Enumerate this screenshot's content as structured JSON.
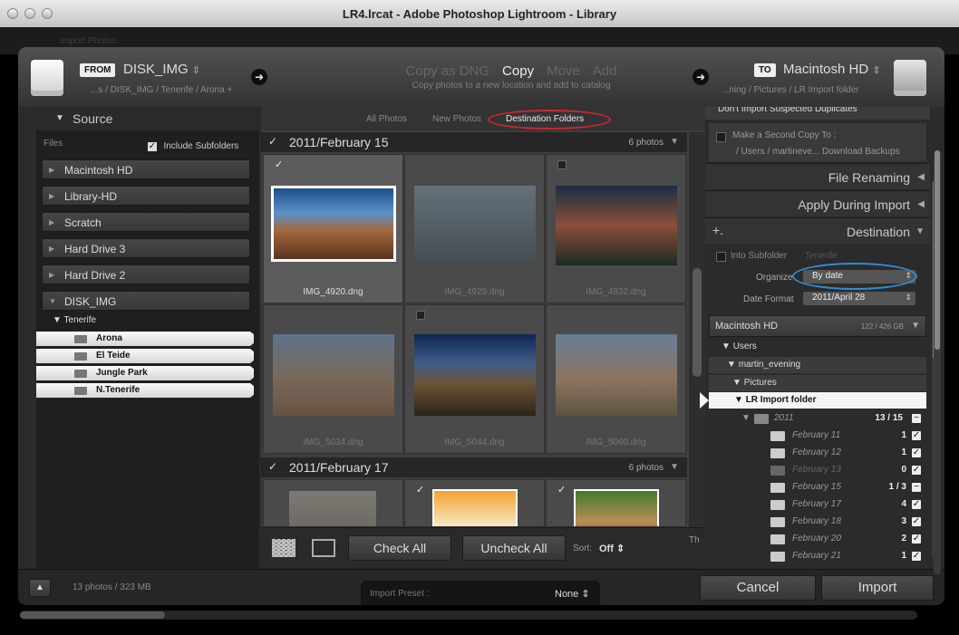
{
  "window": {
    "title": "LR4.lrcat - Adobe Photoshop Lightroom - Library",
    "bg_label": "Import Photos"
  },
  "header": {
    "from_tag": "FROM",
    "source_name": "DISK_IMG",
    "source_path": "...s / DISK_IMG / Tenerife / Arona +",
    "modes": [
      "Copy as DNG",
      "Copy",
      "Move",
      "Add"
    ],
    "active_mode": "Copy",
    "mode_description": "Copy photos to a new location and add to catalog",
    "to_tag": "TO",
    "dest_name": "Macintosh HD",
    "dest_path": "...ning / Pictures / LR Import folder"
  },
  "source": {
    "title": "Source",
    "files_label": "Files",
    "include_subfolders": "Include Subfolders",
    "drives": [
      "Macintosh HD",
      "Library-HD",
      "Scratch",
      "Hard Drive 3",
      "Hard Drive 2",
      "DISK_IMG"
    ],
    "parent_folder": "Tenerife",
    "folders": [
      "Arona",
      "El Teide",
      "Jungle Park",
      "N.Tenerife"
    ]
  },
  "filter_tabs": [
    "All Photos",
    "New Photos",
    "Destination Folders"
  ],
  "groups": [
    {
      "date": "2011/February 15",
      "count": "6 photos"
    },
    {
      "date": "2011/February 17",
      "count": "6 photos"
    }
  ],
  "thumbnails": [
    {
      "name": "IMG_4920.dng",
      "checked": true,
      "selected": true
    },
    {
      "name": "IMG_4929.dng",
      "checked": false,
      "selected": false
    },
    {
      "name": "IMG_4932.dng",
      "checked": false,
      "selected": false
    },
    {
      "name": "IMG_5034.dng",
      "checked": false,
      "selected": false
    },
    {
      "name": "IMG_5044.dng",
      "checked": false,
      "selected": false
    },
    {
      "name": "IMG_5060.dng",
      "checked": false,
      "selected": false
    }
  ],
  "center_footer": {
    "check_all": "Check All",
    "uncheck_all": "Uncheck All",
    "sort_label": "Sort:",
    "sort_value": "Off",
    "thumb_label": "Th"
  },
  "right": {
    "dont_import_dupes": "Don't Import Suspected Duplicates",
    "second_copy_label": "Make a Second Copy To :",
    "second_copy_path": "/ Users / martineve... Download Backups",
    "file_renaming": "File Renaming",
    "apply_during_import": "Apply During Import",
    "destination": "Destination",
    "into_subfolder": "Into Subfolder",
    "subfolder_name": "Tenerife",
    "organize_label": "Organize",
    "organize_value": "By date",
    "date_format_label": "Date Format",
    "date_format_value": "2011/April 28",
    "volume_name": "Macintosh HD",
    "volume_space": "122 / 426 GB",
    "tree": [
      "Users",
      "martin_evening",
      "Pictures",
      "LR Import folder"
    ],
    "year_folder": "2011",
    "year_count": "13 / 15",
    "subfolders": [
      {
        "name": "February 11",
        "count": "1"
      },
      {
        "name": "February 12",
        "count": "1"
      },
      {
        "name": "February 13",
        "count": "0"
      },
      {
        "name": "February 15",
        "count": "1 / 3"
      },
      {
        "name": "February 17",
        "count": "4"
      },
      {
        "name": "February 18",
        "count": "3"
      },
      {
        "name": "February 20",
        "count": "2"
      },
      {
        "name": "February 21",
        "count": "1"
      }
    ]
  },
  "footer": {
    "summary": "13 photos / 323 MB",
    "preset_label": "Import Preset :",
    "preset_value": "None",
    "cancel": "Cancel",
    "import": "Import"
  },
  "colors": {
    "red_highlight": "#d3262f",
    "blue_highlight": "#2b8fd8"
  }
}
